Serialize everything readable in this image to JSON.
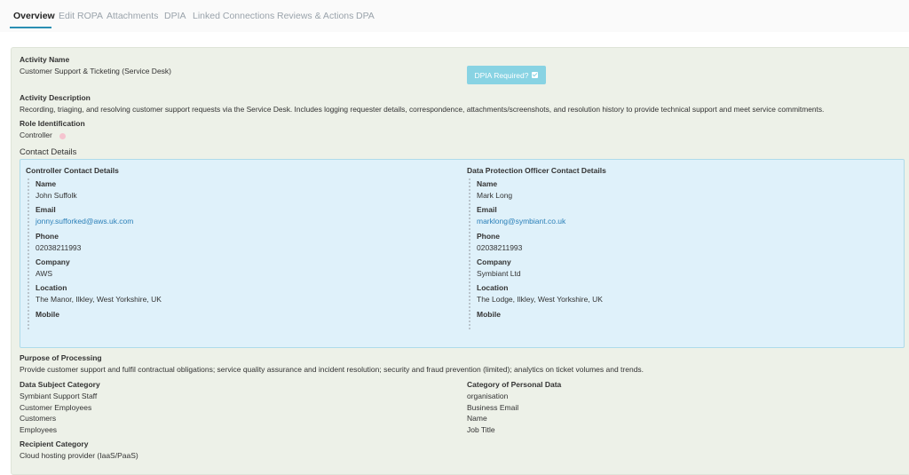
{
  "tabs": [
    {
      "label": "Overview"
    },
    {
      "label": "Edit ROPA"
    },
    {
      "label": "Attachments"
    },
    {
      "label": "DPIA"
    },
    {
      "label": "Linked Connections"
    },
    {
      "label": "Reviews & Actions"
    },
    {
      "label": "DPA"
    }
  ],
  "activity": {
    "name_label": "Activity Name",
    "name": "Customer Support & Ticketing (Service Desk)",
    "dpia_button": "DPIA Required?",
    "description_label": "Activity Description",
    "description": "Recording, triaging, and resolving customer support requests via the Service Desk. Includes logging requester details, correspondence, attachments/screenshots, and resolution history to provide technical support and meet service commitments.",
    "role_label": "Role Identification",
    "role": "Controller"
  },
  "contact": {
    "title": "Contact Details",
    "controller": {
      "heading": "Controller Contact Details",
      "name_label": "Name",
      "name": "John Suffolk",
      "email_label": "Email",
      "email": "jonny.sufforked@aws.uk.com",
      "phone_label": "Phone",
      "phone": "02038211993",
      "company_label": "Company",
      "company": "AWS",
      "location_label": "Location",
      "location": "The Manor, Ilkley, West Yorkshire, UK",
      "mobile_label": "Mobile"
    },
    "dpo": {
      "heading": "Data Protection Officer Contact Details",
      "name_label": "Name",
      "name": "Mark Long",
      "email_label": "Email",
      "email": "marklong@symbiant.co.uk",
      "phone_label": "Phone",
      "phone": "02038211993",
      "company_label": "Company",
      "company": "Symbiant Ltd",
      "location_label": "Location",
      "location": "The Lodge, Ilkley, West Yorkshire, UK",
      "mobile_label": "Mobile"
    }
  },
  "purpose": {
    "label": "Purpose of Processing",
    "text": "Provide customer support and fulfil contractual obligations; service quality assurance and incident resolution; security and fraud prevention (limited); analytics on ticket volumes and trends."
  },
  "data_subject": {
    "label": "Data Subject Category",
    "items": [
      "Symbiant Support Staff",
      "Customer Employees",
      "Customers",
      "Employees"
    ]
  },
  "personal_data": {
    "label": "Category of Personal Data",
    "items": [
      "organisation",
      "Business Email",
      "Name",
      "Job Title"
    ]
  },
  "recipient": {
    "label": "Recipient Category",
    "items": [
      "Cloud hosting provider (IaaS/PaaS)"
    ]
  },
  "colors": {
    "accent": "#2a8fb3",
    "panel_bg": "#edf1e8",
    "contact_bg": "#dff1fa",
    "dpia_button": "#88d3e3",
    "link": "#2a7fb8",
    "role_dot": "#f5c4cf"
  }
}
